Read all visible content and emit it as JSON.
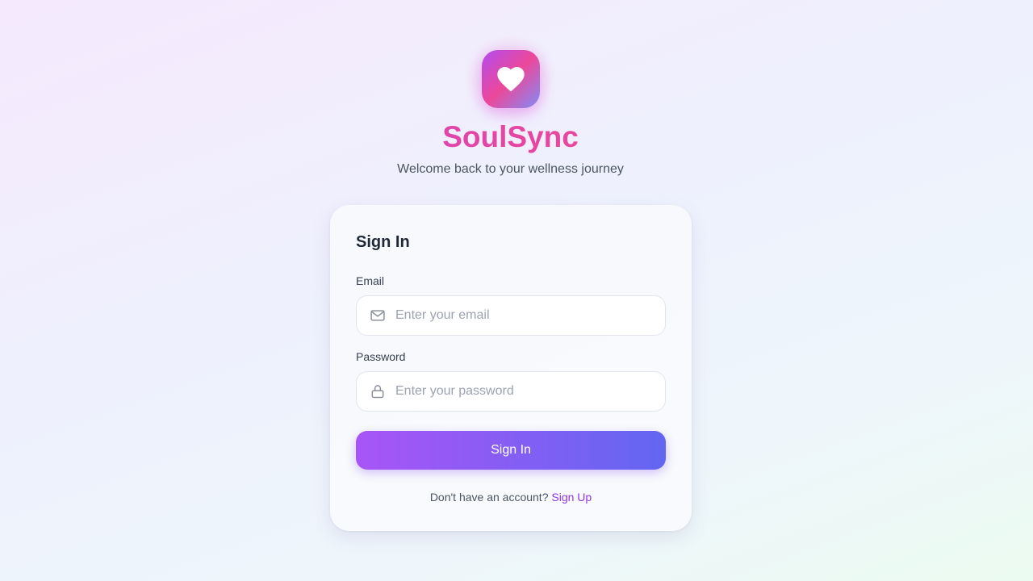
{
  "brand": {
    "name": "SoulSync",
    "tagline": "Welcome back to your wellness journey",
    "logo_icon": "heart-icon"
  },
  "form": {
    "title": "Sign In",
    "email": {
      "label": "Email",
      "placeholder": "Enter your email",
      "value": "",
      "icon": "mail-icon"
    },
    "password": {
      "label": "Password",
      "placeholder": "Enter your password",
      "value": "",
      "icon": "lock-icon"
    },
    "submit_label": "Sign In",
    "signup_prompt": "Don't have an account?",
    "signup_link": "Sign Up"
  },
  "colors": {
    "brand_pink": "#ec4899",
    "brand_purple": "#a855f7",
    "brand_indigo": "#6366f1",
    "link": "#9333ea"
  }
}
